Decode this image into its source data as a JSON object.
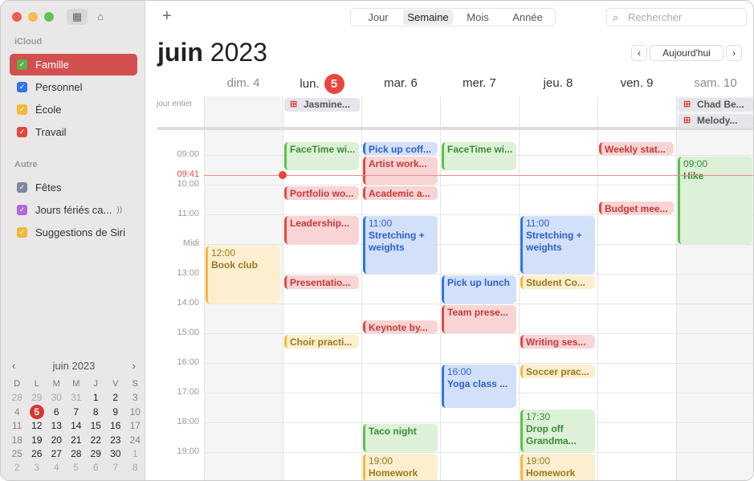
{
  "sidebar": {
    "sections": [
      {
        "label": "iCloud",
        "items": [
          {
            "label": "Famille",
            "color": "#5ab24a",
            "selected": true
          },
          {
            "label": "Personnel",
            "color": "#2f74e8"
          },
          {
            "label": "École",
            "color": "#f2b93a"
          },
          {
            "label": "Travail",
            "color": "#e04a40"
          }
        ]
      },
      {
        "label": "Autre",
        "items": [
          {
            "label": "Fêtes",
            "color": "#7d879d"
          },
          {
            "label": "Jours fériés ca...",
            "color": "#b067d6",
            "broadcast": true
          },
          {
            "label": "Suggestions de Siri",
            "color": "#f2b93a"
          }
        ]
      }
    ],
    "mini_calendar": {
      "title": "juin 2023",
      "today": 5,
      "weekdays": [
        "D",
        "L",
        "M",
        "M",
        "J",
        "V",
        "S"
      ],
      "weeks": [
        [
          28,
          29,
          30,
          31,
          1,
          2,
          3
        ],
        [
          4,
          5,
          6,
          7,
          8,
          9,
          10
        ],
        [
          11,
          12,
          13,
          14,
          15,
          16,
          17
        ],
        [
          18,
          19,
          20,
          21,
          22,
          23,
          24
        ],
        [
          25,
          26,
          27,
          28,
          29,
          30,
          1
        ],
        [
          2,
          3,
          4,
          5,
          6,
          7,
          8
        ]
      ]
    }
  },
  "toolbar": {
    "add": "+",
    "views": [
      "Jour",
      "Semaine",
      "Mois",
      "Année"
    ],
    "active_view": "Semaine",
    "search_placeholder": "Rechercher",
    "today": "Aujourd'hui"
  },
  "header": {
    "month": "juin",
    "year": "2023"
  },
  "days": [
    {
      "label": "dim. 4",
      "weekend": true
    },
    {
      "label": "lun.",
      "num": "5",
      "today": true
    },
    {
      "label": "mar. 6"
    },
    {
      "label": "mer. 7"
    },
    {
      "label": "jeu. 8"
    },
    {
      "label": "ven. 9"
    },
    {
      "label": "sam. 10",
      "weekend": true
    }
  ],
  "all_day_label": "jour entier",
  "all_day_events": [
    {
      "day": 1,
      "title": "Jasmine..."
    },
    {
      "day": 6,
      "title": "Chad Be..."
    },
    {
      "day": 6,
      "title": "Melody..."
    }
  ],
  "time_labels": [
    "09:00",
    "10:00",
    "11:00",
    "Midi",
    "13:00",
    "14:00",
    "15:00",
    "16:00",
    "17:00",
    "18:00",
    "19:00"
  ],
  "now": {
    "label": "09:41",
    "hour": 9.683
  },
  "colors": {
    "Famille": {
      "bg": "#dcf1d7",
      "fg": "#3e8a38",
      "bar": "#5ac04a"
    },
    "Travail": {
      "bg": "#f8d4d4",
      "fg": "#c53a38",
      "bar": "#e5473f"
    },
    "Personnel": {
      "bg": "#d3e0fa",
      "fg": "#2c60cc",
      "bar": "#2f74e8"
    },
    "École": {
      "bg": "#fbefcf",
      "fg": "#9a7720",
      "bar": "#f2b93a"
    }
  },
  "events": [
    {
      "day": 1,
      "start": 8.5,
      "end": 9.5,
      "title": "FaceTime wi...",
      "cal": "Famille"
    },
    {
      "day": 1,
      "start": 10,
      "end": 10.5,
      "title": "Portfolio wo...",
      "cal": "Travail"
    },
    {
      "day": 1,
      "start": 11,
      "end": 12,
      "title": "Leadership...",
      "cal": "Travail"
    },
    {
      "day": 1,
      "start": 13,
      "end": 13.5,
      "title": "Presentatio...",
      "cal": "Travail"
    },
    {
      "day": 1,
      "start": 15,
      "end": 15.5,
      "title": "Choir practi...",
      "cal": "École"
    },
    {
      "day": 2,
      "start": 8.5,
      "end": 9,
      "title": "Pick up coff...",
      "cal": "Personnel"
    },
    {
      "day": 2,
      "start": 9,
      "end": 10,
      "title": "Artist work...",
      "cal": "Travail"
    },
    {
      "day": 2,
      "start": 10,
      "end": 10.5,
      "title": "Academic a...",
      "cal": "Travail"
    },
    {
      "day": 2,
      "start": 11,
      "end": 13,
      "time": "11:00",
      "title": "Stretching + weights",
      "cal": "Personnel",
      "wrap": true
    },
    {
      "day": 2,
      "start": 14.5,
      "end": 15,
      "title": "Keynote by...",
      "cal": "Travail"
    },
    {
      "day": 2,
      "start": 18,
      "end": 19,
      "title": "Taco night",
      "cal": "Famille"
    },
    {
      "day": 2,
      "start": 19,
      "end": 20,
      "time": "19:00",
      "title": "Homework",
      "cal": "École"
    },
    {
      "day": 3,
      "start": 8.5,
      "end": 9.5,
      "title": "FaceTime wi...",
      "cal": "Famille"
    },
    {
      "day": 3,
      "start": 13,
      "end": 14,
      "title": "Pick up lunch",
      "cal": "Personnel"
    },
    {
      "day": 3,
      "start": 14,
      "end": 15,
      "title": "Team prese...",
      "cal": "Travail"
    },
    {
      "day": 3,
      "start": 16,
      "end": 17.5,
      "time": "16:00",
      "title": "Yoga class ...",
      "cal": "Personnel"
    },
    {
      "day": 4,
      "start": 11,
      "end": 13,
      "time": "11:00",
      "title": "Stretching + weights",
      "cal": "Personnel",
      "wrap": true
    },
    {
      "day": 4,
      "start": 13,
      "end": 13.5,
      "title": "Student Co...",
      "cal": "École"
    },
    {
      "day": 4,
      "start": 15,
      "end": 15.5,
      "title": "Writing ses...",
      "cal": "Travail"
    },
    {
      "day": 4,
      "start": 16,
      "end": 16.5,
      "title": "Soccer prac...",
      "cal": "École"
    },
    {
      "day": 4,
      "start": 17.5,
      "end": 19,
      "time": "17:30",
      "title": "Drop off Grandma...",
      "cal": "Famille",
      "wrap": true
    },
    {
      "day": 4,
      "start": 19,
      "end": 20,
      "time": "19:00",
      "title": "Homework",
      "cal": "École"
    },
    {
      "day": 5,
      "start": 8.5,
      "end": 9,
      "title": "Weekly stat...",
      "cal": "Travail"
    },
    {
      "day": 5,
      "start": 10.5,
      "end": 11,
      "title": "Budget mee...",
      "cal": "Travail"
    },
    {
      "day": 6,
      "start": 9,
      "end": 12,
      "time": "09:00",
      "title": "Hike",
      "cal": "Famille"
    },
    {
      "day": 0,
      "start": 12,
      "end": 14,
      "time": "12:00",
      "title": "Book club",
      "cal": "École"
    }
  ]
}
